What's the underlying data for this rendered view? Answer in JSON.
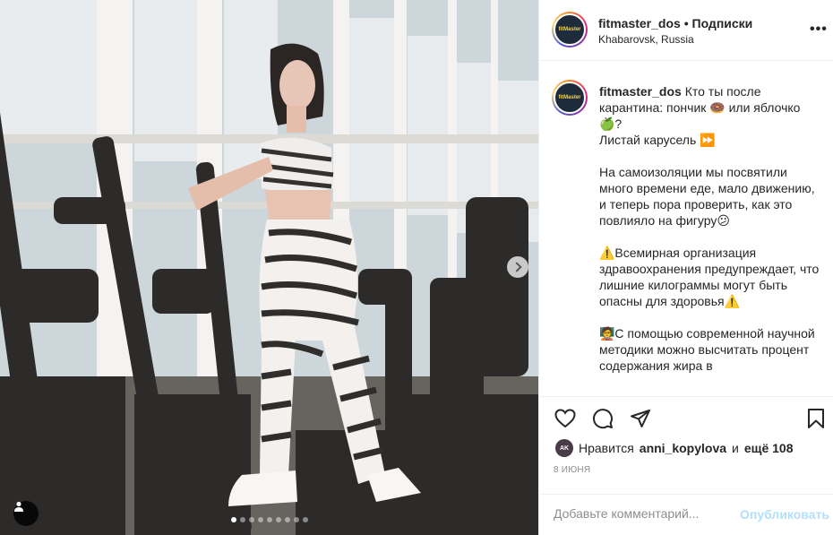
{
  "post": {
    "username": "fitmaster_dos",
    "separator": "•",
    "follow_label": "Подписки",
    "location": "Khabarovsk, Russia",
    "more_label": "•••",
    "avatar_text": "fitMaster"
  },
  "caption": {
    "username": "fitmaster_dos",
    "text": " Кто ты после карантина: пончик 🍩 или яблочко 🍏?\nЛистай карусель ⏩\n\nНа самоизоляции мы посвятили много времени еде, мало движению, и теперь пора проверить, как это повлияло на фигуру😕\n\n⚠️Всемирная организация здравоохранения предупреждает, что лишние килограммы могут быть опасны для здоровья⚠️\n\n🧑‍🏫С помощью современной научной методики можно высчитать процент содержания жира в"
  },
  "actions": {
    "like_icon": "heart-icon",
    "comment_icon": "comment-icon",
    "share_icon": "share-icon",
    "save_icon": "bookmark-icon"
  },
  "likes": {
    "prefix": "Нравится",
    "user": "anni_kopylova",
    "conj": "и",
    "others": "ещё 108"
  },
  "date": "8 ИЮНЯ",
  "comment": {
    "placeholder": "Добавьте комментарий...",
    "publish_label": "Опубликовать"
  },
  "carousel": {
    "total": 9,
    "active": 0
  },
  "colors": {
    "accent_disabled": "#b2dffc",
    "text": "#262626",
    "muted": "#8e8e8e"
  }
}
